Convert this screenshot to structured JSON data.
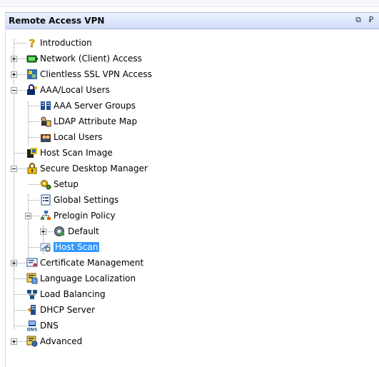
{
  "panel": {
    "title": "Remote Access VPN",
    "restore_symbol": "⧉",
    "pin_symbol": "Ꝑ"
  },
  "tree": {
    "items": [
      {
        "label": "Introduction",
        "icon": "question-icon"
      },
      {
        "label": "Network (Client) Access",
        "icon": "network-client-icon"
      },
      {
        "label": "Clientless SSL VPN Access",
        "icon": "clientless-vpn-icon"
      },
      {
        "label": "AAA/Local Users",
        "icon": "users-lock-icon"
      },
      {
        "label": "AAA Server Groups",
        "icon": "server-groups-icon"
      },
      {
        "label": "LDAP Attribute Map",
        "icon": "ldap-map-icon"
      },
      {
        "label": "Local Users",
        "icon": "local-users-icon"
      },
      {
        "label": "Host Scan Image",
        "icon": "host-scan-image-icon"
      },
      {
        "label": "Secure Desktop Manager",
        "icon": "secure-desktop-icon"
      },
      {
        "label": "Setup",
        "icon": "setup-gears-icon"
      },
      {
        "label": "Global Settings",
        "icon": "settings-list-icon"
      },
      {
        "label": "Prelogin Policy",
        "icon": "policy-tree-icon"
      },
      {
        "label": "Default",
        "icon": "default-policy-icon"
      },
      {
        "label": "Host Scan",
        "icon": "host-scan-icon",
        "selected": true
      },
      {
        "label": "Certificate Management",
        "icon": "certificate-icon"
      },
      {
        "label": "Language Localization",
        "icon": "language-icon"
      },
      {
        "label": "Load Balancing",
        "icon": "load-balancing-icon"
      },
      {
        "label": "DHCP Server",
        "icon": "dhcp-server-icon"
      },
      {
        "label": "DNS",
        "icon": "dns-icon"
      },
      {
        "label": "Advanced",
        "icon": "advanced-icon"
      }
    ]
  },
  "colors": {
    "selection": "#3399ff",
    "title_gradient_top": "#eef3ff",
    "title_gradient_bottom": "#cfdcf8"
  }
}
